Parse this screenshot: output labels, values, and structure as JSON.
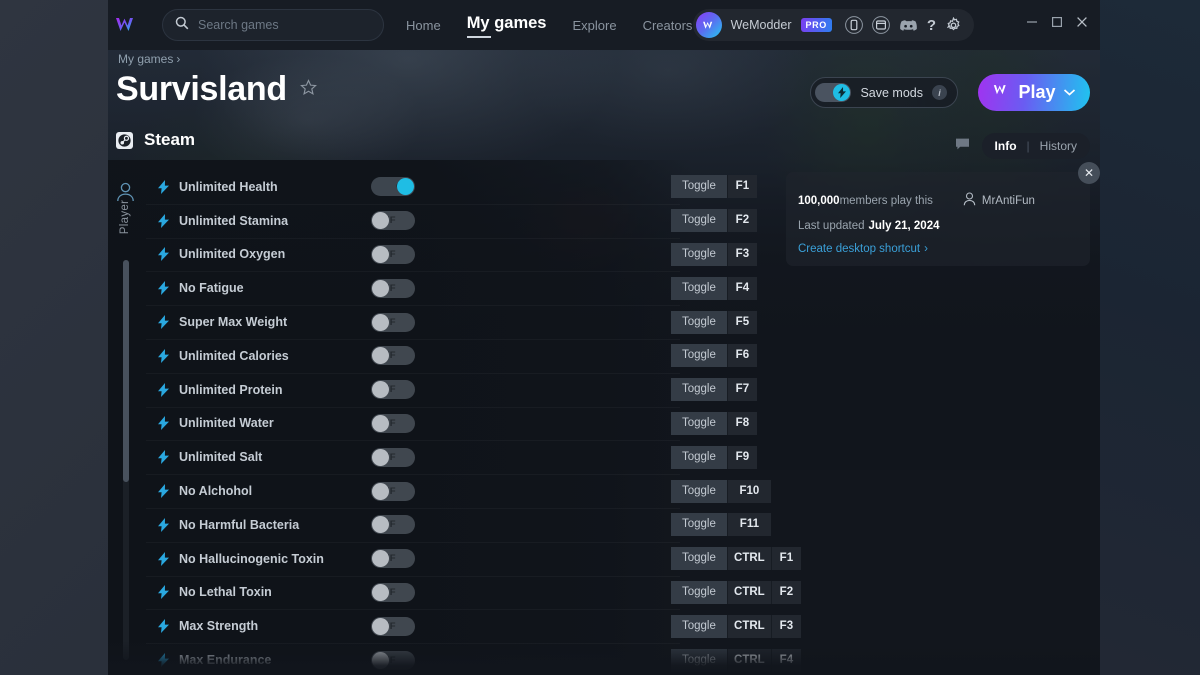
{
  "theme": {
    "accent_cyan": "#1fbde4",
    "accent_purple": "#a033f0",
    "link_blue": "#3aa0d8",
    "window_bg": "#12161d",
    "topbar_bg": "#171c24"
  },
  "topbar": {
    "logo_icon": "wemod-w-logo",
    "search": {
      "icon": "search-icon",
      "placeholder": "Search games",
      "value": ""
    },
    "nav": [
      {
        "label": "Home",
        "active": false
      },
      {
        "label": "My games",
        "active": true
      },
      {
        "label": "Explore",
        "active": false
      },
      {
        "label": "Creators",
        "active": false
      }
    ],
    "account": {
      "avatar_icon": "wemod-avatar",
      "name": "WeModder",
      "badge": "PRO"
    },
    "icons": [
      {
        "name": "phone-icon"
      },
      {
        "name": "desktop-app-icon"
      },
      {
        "name": "discord-icon"
      },
      {
        "name": "help-icon"
      },
      {
        "name": "gear-icon"
      }
    ],
    "window_controls": [
      {
        "name": "minimize-button",
        "glyph": "–"
      },
      {
        "name": "maximize-button",
        "glyph": "□"
      },
      {
        "name": "close-button",
        "glyph": "✕"
      }
    ]
  },
  "header": {
    "breadcrumb": "My games",
    "breadcrumb_chevron": "›",
    "title": "Survisland",
    "favorite_icon": "star-outline-icon",
    "save_mods": {
      "label": "Save mods",
      "toggle_state": "on",
      "toggle_icon": "bolt-icon",
      "info_glyph": "i"
    },
    "play": {
      "label": "Play",
      "logo_icon": "wemod-w-logo",
      "chevron_icon": "chevron-down-icon"
    }
  },
  "platform": {
    "icon": "steam-icon",
    "name": "Steam"
  },
  "tabs": {
    "note_icon": "note-icon",
    "items": [
      {
        "label": "Info",
        "active": true
      },
      {
        "label": "History",
        "active": false
      }
    ],
    "separator": "|"
  },
  "info_card": {
    "close_glyph": "✕",
    "members_count": "100,000",
    "members_text": " members play this",
    "author_icon": "person-icon",
    "author_name": "MrAntiFun",
    "updated_label": "Last updated",
    "updated_date": "July 21, 2024",
    "shortcut_label": "Create desktop shortcut",
    "shortcut_chevron": "›"
  },
  "category_rail": {
    "icon": "person-icon",
    "label": "Player",
    "scrollbar": "vertical-scrollbar"
  },
  "cheats": {
    "toggle_label": "Toggle",
    "rows": [
      {
        "name": "Unlimited Health",
        "state": "ON",
        "keys": [
          "F1"
        ]
      },
      {
        "name": "Unlimited Stamina",
        "state": "OFF",
        "keys": [
          "F2"
        ]
      },
      {
        "name": "Unlimited Oxygen",
        "state": "OFF",
        "keys": [
          "F3"
        ]
      },
      {
        "name": "No Fatigue",
        "state": "OFF",
        "keys": [
          "F4"
        ]
      },
      {
        "name": "Super Max Weight",
        "state": "OFF",
        "keys": [
          "F5"
        ]
      },
      {
        "name": "Unlimited Calories",
        "state": "OFF",
        "keys": [
          "F6"
        ]
      },
      {
        "name": "Unlimited Protein",
        "state": "OFF",
        "keys": [
          "F7"
        ]
      },
      {
        "name": "Unlimited Water",
        "state": "OFF",
        "keys": [
          "F8"
        ]
      },
      {
        "name": "Unlimited Salt",
        "state": "OFF",
        "keys": [
          "F9"
        ]
      },
      {
        "name": "No Alchohol",
        "state": "OFF",
        "keys": [
          "F10"
        ]
      },
      {
        "name": "No Harmful Bacteria",
        "state": "OFF",
        "keys": [
          "F11"
        ]
      },
      {
        "name": "No Hallucinogenic Toxin",
        "state": "OFF",
        "keys": [
          "CTRL",
          "F1"
        ]
      },
      {
        "name": "No Lethal Toxin",
        "state": "OFF",
        "keys": [
          "CTRL",
          "F2"
        ]
      },
      {
        "name": "Max Strength",
        "state": "OFF",
        "keys": [
          "CTRL",
          "F3"
        ]
      },
      {
        "name": "Max Endurance",
        "state": "OFF",
        "keys": [
          "CTRL",
          "F4"
        ]
      }
    ]
  }
}
